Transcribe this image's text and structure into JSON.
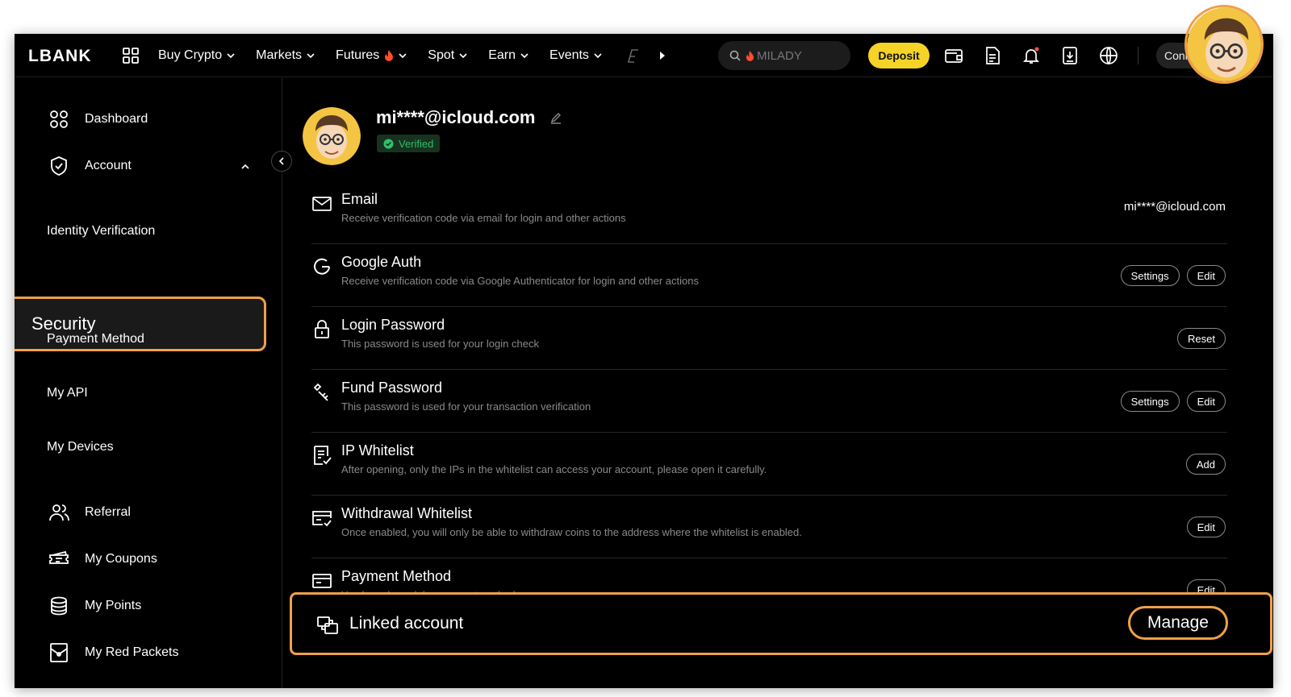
{
  "header": {
    "logo": "LBANK",
    "nav": [
      {
        "label": "Buy Crypto",
        "has_chevron": true
      },
      {
        "label": "Markets",
        "has_chevron": true
      },
      {
        "label": "Futures",
        "has_chevron": true,
        "hot": true
      },
      {
        "label": "Spot",
        "has_chevron": true
      },
      {
        "label": "Earn",
        "has_chevron": true
      },
      {
        "label": "Events",
        "has_chevron": true
      }
    ],
    "search_placeholder": "MILADY",
    "deposit_label": "Deposit",
    "connect_label": "Connect",
    "icons": [
      "apps-grid-icon",
      "wallet-icon",
      "document-icon",
      "bell-icon",
      "download-icon",
      "globe-icon"
    ],
    "accent_color": "#f5d327"
  },
  "sidebar": {
    "items": [
      {
        "label": "Dashboard",
        "icon": "dashboard-icon"
      },
      {
        "label": "Account",
        "icon": "shield-icon",
        "expanded": true
      },
      {
        "label": "Identity Verification"
      },
      {
        "label": "Security",
        "selected": true
      },
      {
        "label": "Payment Method"
      },
      {
        "label": "My API"
      },
      {
        "label": "My Devices"
      },
      {
        "label": "Referral",
        "icon": "users-icon"
      },
      {
        "label": "My Coupons",
        "icon": "ticket-icon"
      },
      {
        "label": "My Points",
        "icon": "coins-icon"
      },
      {
        "label": "My Red Packets",
        "icon": "envelope-icon"
      }
    ]
  },
  "profile": {
    "email": "mi****@icloud.com",
    "status": "Verified"
  },
  "security_rows": [
    {
      "title": "Email",
      "desc": "Receive verification code via email for login and other actions",
      "value": "mi****@icloud.com",
      "icon": "mail-icon"
    },
    {
      "title": "Google Auth",
      "desc": "Receive verification code via Google Authenticator for login and other actions",
      "buttons": [
        "Settings",
        "Edit"
      ],
      "icon": "google-icon"
    },
    {
      "title": "Login Password",
      "desc": "This password is used for your login check",
      "buttons": [
        "Reset"
      ],
      "icon": "lock-icon"
    },
    {
      "title": "Fund Password",
      "desc": "This password is used for your transaction verification",
      "buttons": [
        "Settings",
        "Edit"
      ],
      "icon": "key-icon"
    },
    {
      "title": "IP Whitelist",
      "desc": "After opening, only the IPs in the whitelist can access your account, please open it carefully.",
      "buttons": [
        "Add"
      ],
      "icon": "checklist-icon"
    },
    {
      "title": "Withdrawal Whitelist",
      "desc": "Once enabled, you will only be able to withdraw coins to the address where the whitelist is enabled.",
      "buttons": [
        "Edit"
      ],
      "icon": "card-check-icon"
    },
    {
      "title": "Payment Method",
      "desc": "You have bound the payment method",
      "buttons": [
        "Edit"
      ],
      "icon": "payment-card-icon"
    }
  ],
  "linked_account": {
    "title": "Linked account",
    "button": "Manage",
    "highlight_color": "#f0a049"
  }
}
